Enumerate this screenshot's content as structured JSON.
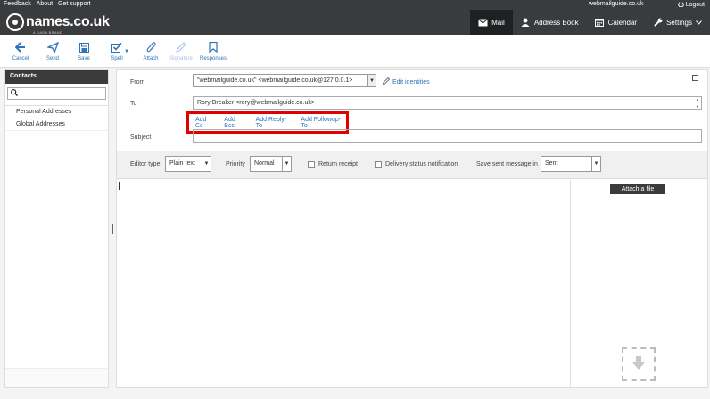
{
  "topbar": {
    "links": [
      "Feedback",
      "About",
      "Get support"
    ],
    "domain": "webmailguide.co.uk",
    "logout": "Logout"
  },
  "header": {
    "logo_text": "names.co.uk",
    "logo_tagline": "A DADA BRAND",
    "nav": [
      {
        "label": "Mail",
        "icon": "mail-icon",
        "active": true
      },
      {
        "label": "Address Book",
        "icon": "person-icon",
        "active": false
      },
      {
        "label": "Calendar",
        "icon": "calendar-icon",
        "active": false
      },
      {
        "label": "Settings",
        "icon": "wrench-icon",
        "active": false
      }
    ]
  },
  "toolbar": {
    "cancel": "Cancel",
    "send": "Send",
    "save": "Save",
    "spell": "Spell",
    "attach": "Attach",
    "signature": "Signature",
    "responses": "Responses"
  },
  "sidebar": {
    "title": "Contacts",
    "items": [
      "Personal Addresses",
      "Global Addresses"
    ]
  },
  "compose": {
    "from_label": "From",
    "from_value": "\"webmailguide.co.uk\" <webmailguide.co.uk@127.0.0.1>",
    "edit_identities": "Edit identities",
    "to_label": "To",
    "to_value": "Rory Breaker <rory@webmailguide.co.uk>",
    "add_links": [
      "Add Cc",
      "Add Bcc",
      "Add Reply-To",
      "Add Followup-To"
    ],
    "subject_label": "Subject",
    "subject_value": "",
    "options": {
      "editor_type_label": "Editor type",
      "editor_type_value": "Plain text",
      "priority_label": "Priority",
      "priority_value": "Normal",
      "return_receipt_label": "Return receipt",
      "return_receipt_checked": false,
      "delivery_status_label": "Delivery status notification",
      "delivery_status_checked": false,
      "save_sent_label": "Save sent message in",
      "save_sent_value": "Sent"
    },
    "attach_button": "Attach a file"
  },
  "colors": {
    "header_bg": "#3a3b3d",
    "accent_blue": "#2e73b8",
    "highlight_red": "#e00000"
  }
}
